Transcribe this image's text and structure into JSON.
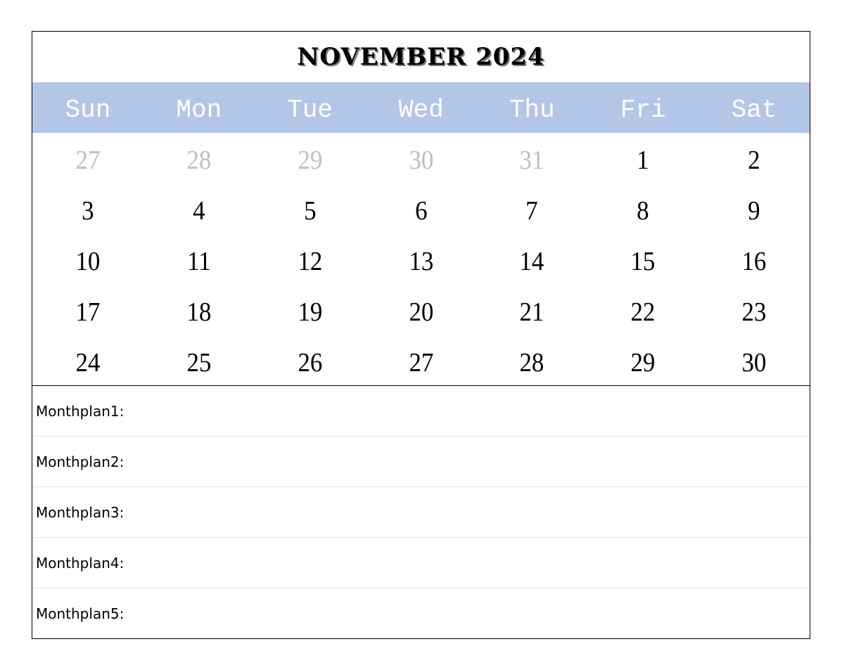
{
  "calendar": {
    "title": "November 2024",
    "header_color": "#B4C6E7",
    "muted_color": "#BFBFBF",
    "weekdays": [
      "Sun",
      "Mon",
      "Tue",
      "Wed",
      "Thu",
      "Fri",
      "Sat"
    ],
    "weeks": [
      [
        {
          "day": "27",
          "in_month": false
        },
        {
          "day": "28",
          "in_month": false
        },
        {
          "day": "29",
          "in_month": false
        },
        {
          "day": "30",
          "in_month": false
        },
        {
          "day": "31",
          "in_month": false
        },
        {
          "day": "1",
          "in_month": true
        },
        {
          "day": "2",
          "in_month": true
        }
      ],
      [
        {
          "day": "3",
          "in_month": true
        },
        {
          "day": "4",
          "in_month": true
        },
        {
          "day": "5",
          "in_month": true
        },
        {
          "day": "6",
          "in_month": true
        },
        {
          "day": "7",
          "in_month": true
        },
        {
          "day": "8",
          "in_month": true
        },
        {
          "day": "9",
          "in_month": true
        }
      ],
      [
        {
          "day": "10",
          "in_month": true
        },
        {
          "day": "11",
          "in_month": true
        },
        {
          "day": "12",
          "in_month": true
        },
        {
          "day": "13",
          "in_month": true
        },
        {
          "day": "14",
          "in_month": true
        },
        {
          "day": "15",
          "in_month": true
        },
        {
          "day": "16",
          "in_month": true
        }
      ],
      [
        {
          "day": "17",
          "in_month": true
        },
        {
          "day": "18",
          "in_month": true
        },
        {
          "day": "19",
          "in_month": true
        },
        {
          "day": "20",
          "in_month": true
        },
        {
          "day": "21",
          "in_month": true
        },
        {
          "day": "22",
          "in_month": true
        },
        {
          "day": "23",
          "in_month": true
        }
      ],
      [
        {
          "day": "24",
          "in_month": true
        },
        {
          "day": "25",
          "in_month": true
        },
        {
          "day": "26",
          "in_month": true
        },
        {
          "day": "27",
          "in_month": true
        },
        {
          "day": "28",
          "in_month": true
        },
        {
          "day": "29",
          "in_month": true
        },
        {
          "day": "30",
          "in_month": true
        }
      ]
    ]
  },
  "plans": [
    {
      "label": "Monthplan1:",
      "value": ""
    },
    {
      "label": "Monthplan2:",
      "value": ""
    },
    {
      "label": "Monthplan3:",
      "value": ""
    },
    {
      "label": "Monthplan4:",
      "value": ""
    },
    {
      "label": "Monthplan5:",
      "value": ""
    }
  ]
}
